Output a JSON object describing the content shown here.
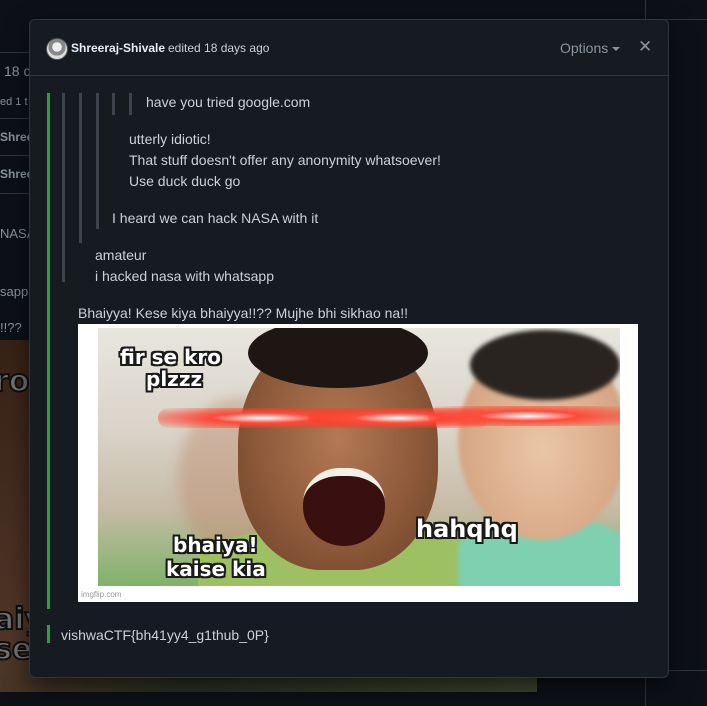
{
  "background": {
    "rows": [
      {
        "text": "18 c"
      },
      {
        "text": "ed 1 t"
      },
      {
        "text": "Shree"
      },
      {
        "text": "Shree"
      }
    ],
    "snippets": [
      {
        "text": "NASA"
      },
      {
        "text": "sapp"
      },
      {
        "text": "!!??"
      }
    ],
    "image_texts": [
      "ro",
      "aiy",
      "se"
    ]
  },
  "modal": {
    "author": "Shreeraj-Shivale",
    "edited": "edited 18 days ago",
    "options_label": "Options",
    "close_glyph": "✕"
  },
  "content": {
    "q1": "have you tried google.com",
    "q2_lines": [
      "utterly idiotic!",
      "That stuff doesn't offer any anonymity whatsoever!",
      "Use duck duck go"
    ],
    "q3": "I heard we can hack NASA with it",
    "q4_lines": [
      "amateur",
      "i hacked nasa with whatsapp"
    ],
    "q5": "Bhaiyya! Kese kiya bhaiyya!!?? Mujhe bhi sikhao na!!",
    "meme": {
      "text_top_1": "fir se kro",
      "text_top_2": "plzzz",
      "text_bottom_1": "bhaiya!",
      "text_bottom_2": "kaise kia",
      "text_right": "hahqhq",
      "watermark": "imgflip.com"
    },
    "flag": "vishwaCTF{bh41yy4_g1thub_0P}"
  },
  "colors": {
    "background": "#0d1117",
    "modal": "#161b22",
    "border": "#30363d",
    "accent_green": "#2ea043",
    "text": "#c9d1d9",
    "muted": "#8b949e"
  }
}
